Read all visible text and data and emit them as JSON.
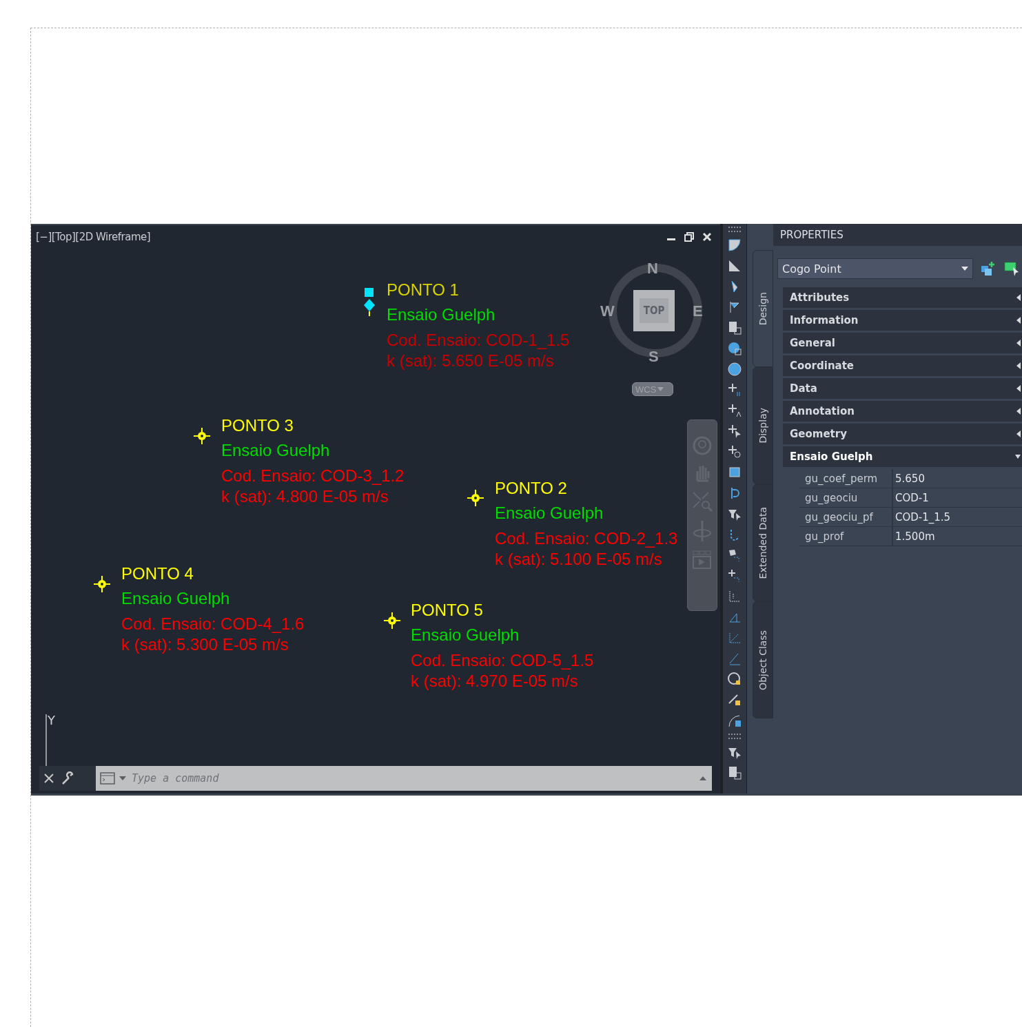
{
  "viewport": {
    "label": "[−][Top][2D Wireframe]",
    "compass": {
      "north": "N",
      "south": "S",
      "east": "E",
      "west": "W",
      "face": "TOP",
      "system": "WCS"
    },
    "ucs": {
      "axis": "Y"
    },
    "points": [
      {
        "title": "PONTO 1",
        "subtitle": "Ensaio Guelph",
        "code": "Cod. Ensaio: COD-1_1.5",
        "k": "k (sat): 5.650 E-05 m/s",
        "selected": true
      },
      {
        "title": "PONTO 3",
        "subtitle": "Ensaio Guelph",
        "code": "Cod. Ensaio: COD-3_1.2",
        "k": "k (sat): 4.800 E-05 m/s",
        "selected": false
      },
      {
        "title": "PONTO 2",
        "subtitle": "Ensaio Guelph",
        "code": "Cod. Ensaio: COD-2_1.3",
        "k": "k (sat): 5.100 E-05 m/s",
        "selected": false
      },
      {
        "title": "PONTO 4",
        "subtitle": "Ensaio Guelph",
        "code": "Cod. Ensaio: COD-4_1.6",
        "k": "k (sat): 5.300 E-05 m/s",
        "selected": false
      },
      {
        "title": "PONTO 5",
        "subtitle": "Ensaio Guelph",
        "code": "Cod. Ensaio: COD-5_1.5",
        "k": "k (sat): 4.970 E-05 m/s",
        "selected": false
      }
    ],
    "command_line": {
      "placeholder": "Type a command"
    }
  },
  "properties": {
    "title": "PROPERTIES",
    "object_type": "Cogo Point",
    "side_tabs": [
      {
        "label": "Design",
        "selected": true
      },
      {
        "label": "Display",
        "selected": false
      },
      {
        "label": "Extended Data",
        "selected": false
      },
      {
        "label": "Object Class",
        "selected": false
      }
    ],
    "sections": [
      {
        "label": "Attributes",
        "expanded": false
      },
      {
        "label": "Information",
        "expanded": false
      },
      {
        "label": "General",
        "expanded": false
      },
      {
        "label": "Coordinate",
        "expanded": false
      },
      {
        "label": "Data",
        "expanded": false
      },
      {
        "label": "Annotation",
        "expanded": false
      },
      {
        "label": "Geometry",
        "expanded": false
      },
      {
        "label": "Ensaio Guelph",
        "expanded": true
      }
    ],
    "fields": [
      {
        "name": "gu_coef_perm",
        "value": "5.650"
      },
      {
        "name": "gu_geociu",
        "value": "COD-1"
      },
      {
        "name": "gu_geociu_pf",
        "value": "COD-1_1.5"
      },
      {
        "name": "gu_prof",
        "value": "1.500m"
      }
    ]
  }
}
